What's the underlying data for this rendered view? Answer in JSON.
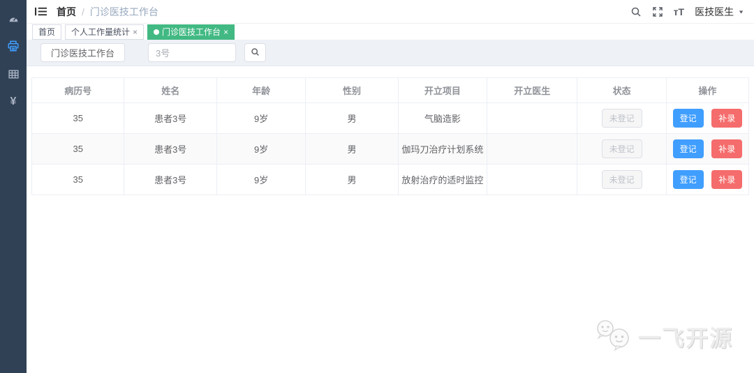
{
  "colors": {
    "sidebar_bg": "#304156",
    "tab_active_green": "#42b983",
    "primary_blue": "#409eff",
    "danger_red": "#f56c6c",
    "toolbar_bg": "#eef1f6"
  },
  "glyphs": {
    "close": "×",
    "caret_down": "▼",
    "font_size_icon": "тT",
    "yen_icon": "¥",
    "breadcrumb_separator": "/"
  },
  "sidebar": {
    "items": [
      {
        "icon": "dashboard-icon"
      },
      {
        "icon": "medtech-printer-icon",
        "active": true
      },
      {
        "icon": "table-icon"
      },
      {
        "icon": "fees-yen-icon"
      }
    ]
  },
  "navbar": {
    "breadcrumb": {
      "home": "首页",
      "current": "门诊医技工作台"
    },
    "user_name": "医技医生"
  },
  "tabs": [
    {
      "label": "首页",
      "active": false,
      "closable": false
    },
    {
      "label": "个人工作量统计",
      "active": false,
      "closable": true
    },
    {
      "label": "门诊医技工作台",
      "active": true,
      "closable": true
    }
  ],
  "toolbar": {
    "title_button": "门诊医技工作台",
    "search_value": "3号"
  },
  "table": {
    "columns": [
      "病历号",
      "姓名",
      "年龄",
      "性别",
      "开立项目",
      "开立医生",
      "状态",
      "操作"
    ],
    "action_labels": {
      "register": "登记",
      "makeup": "补录"
    },
    "rows": [
      {
        "record_no": "35",
        "name": "患者3号",
        "age": "9岁",
        "gender": "男",
        "project": "气脑造影",
        "doctor": "",
        "status": "未登记"
      },
      {
        "record_no": "35",
        "name": "患者3号",
        "age": "9岁",
        "gender": "男",
        "project": "伽玛刀治疗计划系统",
        "doctor": "",
        "status": "未登记"
      },
      {
        "record_no": "35",
        "name": "患者3号",
        "age": "9岁",
        "gender": "男",
        "project": "放射治疗的适时监控",
        "doctor": "",
        "status": "未登记"
      }
    ]
  },
  "watermark": {
    "text": "一飞开源"
  }
}
